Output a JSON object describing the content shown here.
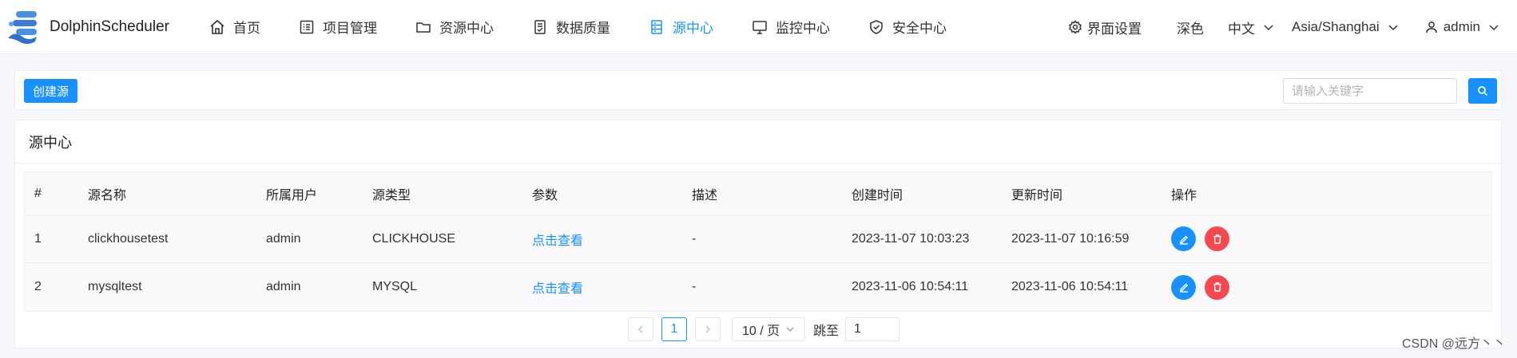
{
  "brand": {
    "name": "DolphinScheduler"
  },
  "nav": [
    {
      "label": "首页",
      "icon": "home-icon"
    },
    {
      "label": "项目管理",
      "icon": "list-icon"
    },
    {
      "label": "资源中心",
      "icon": "folder-icon"
    },
    {
      "label": "数据质量",
      "icon": "document-check-icon"
    },
    {
      "label": "源中心",
      "icon": "database-icon",
      "active": true
    },
    {
      "label": "监控中心",
      "icon": "monitor-icon"
    },
    {
      "label": "安全中心",
      "icon": "shield-icon"
    }
  ],
  "header": {
    "settings_label": "界面设置",
    "theme_label": "深色",
    "language": "中文",
    "timezone": "Asia/Shanghai",
    "user": "admin"
  },
  "toolbar": {
    "create_label": "创建源",
    "search_placeholder": "请输入关键字"
  },
  "card": {
    "title": "源中心"
  },
  "table": {
    "columns": [
      "#",
      "源名称",
      "所属用户",
      "源类型",
      "参数",
      "描述",
      "创建时间",
      "更新时间",
      "操作"
    ],
    "rows": [
      {
        "index": "1",
        "name": "clickhousetest",
        "user": "admin",
        "type": "CLICKHOUSE",
        "params": "点击查看",
        "desc": "-",
        "created": "2023-11-07 10:03:23",
        "updated": "2023-11-07 10:16:59"
      },
      {
        "index": "2",
        "name": "mysqltest",
        "user": "admin",
        "type": "MYSQL",
        "params": "点击查看",
        "desc": "-",
        "created": "2023-11-06 10:54:11",
        "updated": "2023-11-06 10:54:11"
      }
    ]
  },
  "pagination": {
    "current_page": "1",
    "page_size_label": "10 / 页",
    "jump_label": "跳至",
    "jump_value": "1"
  },
  "watermark": "CSDN @远方丶丶",
  "colors": {
    "primary": "#1890ff",
    "danger": "#f5484f"
  }
}
